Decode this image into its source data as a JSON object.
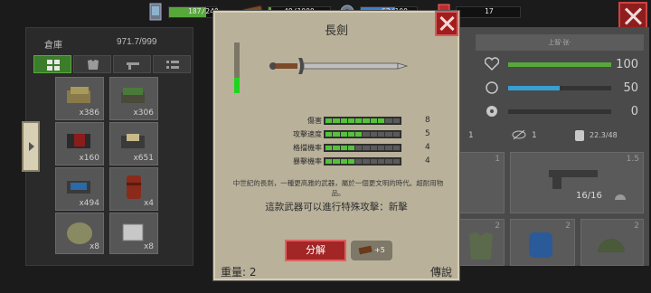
{
  "resources": {
    "food": {
      "value": "187/240",
      "fill": 0.78,
      "color": "#56a83a"
    },
    "wood": {
      "value": "49/1000",
      "fill": 0.05,
      "color": "#56a83a"
    },
    "energy": {
      "value": "62/100",
      "fill": 0.62,
      "color": "#3b7fd4"
    },
    "cash": {
      "value": "17",
      "icon": "cash-icon"
    }
  },
  "storage": {
    "title": "倉庫",
    "capacity": "971.7/999",
    "tabs": [
      "grid-icon",
      "armor-icon",
      "gun-icon",
      "list-icon"
    ],
    "slots": [
      {
        "count": "x386",
        "icon": "cloth-stack-icon"
      },
      {
        "count": "x306",
        "icon": "herb-stack-icon"
      },
      {
        "count": "x160",
        "icon": "fabric-stack-icon"
      },
      {
        "count": "x651",
        "icon": "parts-stack-icon"
      },
      {
        "count": "x494",
        "icon": "wire-stack-icon"
      },
      {
        "count": "x4",
        "icon": "barrel-icon"
      },
      {
        "count": "x8",
        "icon": "sack-icon"
      },
      {
        "count": "x8",
        "icon": "crate-icon"
      }
    ]
  },
  "character": {
    "name": "上智·张·",
    "stats": [
      {
        "icon": "heart-icon",
        "value": "100",
        "fill": 1.0,
        "color": "#56a83a"
      },
      {
        "icon": "stomach-icon",
        "value": "50",
        "fill": 0.5,
        "color": "#3a9fd0"
      },
      {
        "icon": "radiation-icon",
        "value": "0",
        "fill": 0.0,
        "color": "#56a83a"
      }
    ],
    "sub_stats": [
      "1",
      "1",
      "22.3/48"
    ],
    "weapon_ammo": "16/16",
    "weapon_slot": "1.5"
  },
  "dialog": {
    "title": "長劍",
    "durability_fill": 0.3,
    "stats": [
      {
        "label": "傷害",
        "value": "8",
        "level": 8
      },
      {
        "label": "攻擊速度",
        "value": "5",
        "level": 5
      },
      {
        "label": "格擋機率",
        "value": "4",
        "level": 4
      },
      {
        "label": "暴擊機率",
        "value": "4",
        "level": 4
      }
    ],
    "description": "中世紀的長劍，一種更高雅的武器，屬於一個更文明的時代。超耐用物品。",
    "special": "這款武器可以進行特殊攻擊：新擊",
    "dismantle_label": "分解",
    "dismantle_yield": "+5",
    "weight": "重量: 2",
    "rarity": "傳說"
  }
}
